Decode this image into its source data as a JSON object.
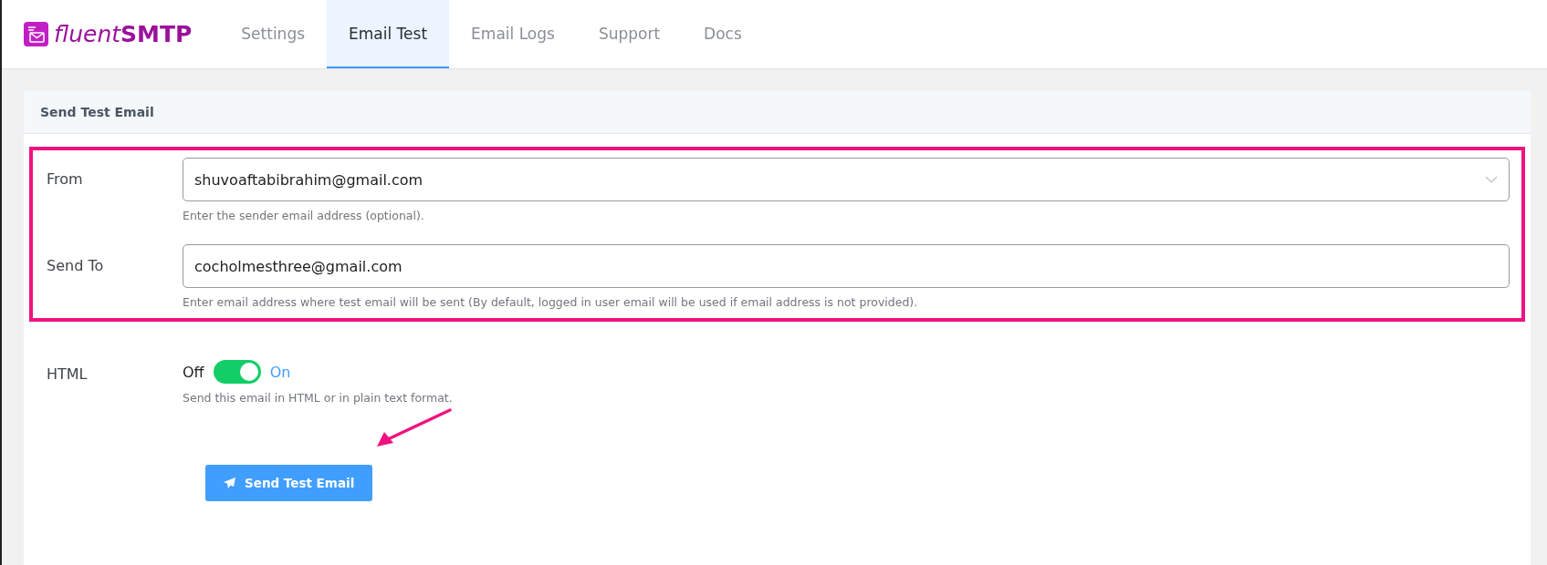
{
  "logo": {
    "light": "fluent",
    "bold": "SMTP"
  },
  "tabs": [
    {
      "label": "Settings",
      "selected": false
    },
    {
      "label": "Email Test",
      "selected": true
    },
    {
      "label": "Email Logs",
      "selected": false
    },
    {
      "label": "Support",
      "selected": false
    },
    {
      "label": "Docs",
      "selected": false
    }
  ],
  "card": {
    "title": "Send Test Email"
  },
  "fields": [
    {
      "kind": "select",
      "label": "From",
      "value": "shuvoaftabibrahim@gmail.com",
      "help": "Enter the sender email address (optional)."
    },
    {
      "kind": "input",
      "label": "Send To",
      "value": "cocholmesthree@gmail.com",
      "help": "Enter email address where test email will be sent (By default, logged in user email will be used if email address is not provided)."
    }
  ],
  "html": {
    "label": "HTML",
    "off_label": "Off",
    "on_label": "On",
    "on": true,
    "help": "Send this email in HTML or in plain text format."
  },
  "send_button": "Send Test Email"
}
